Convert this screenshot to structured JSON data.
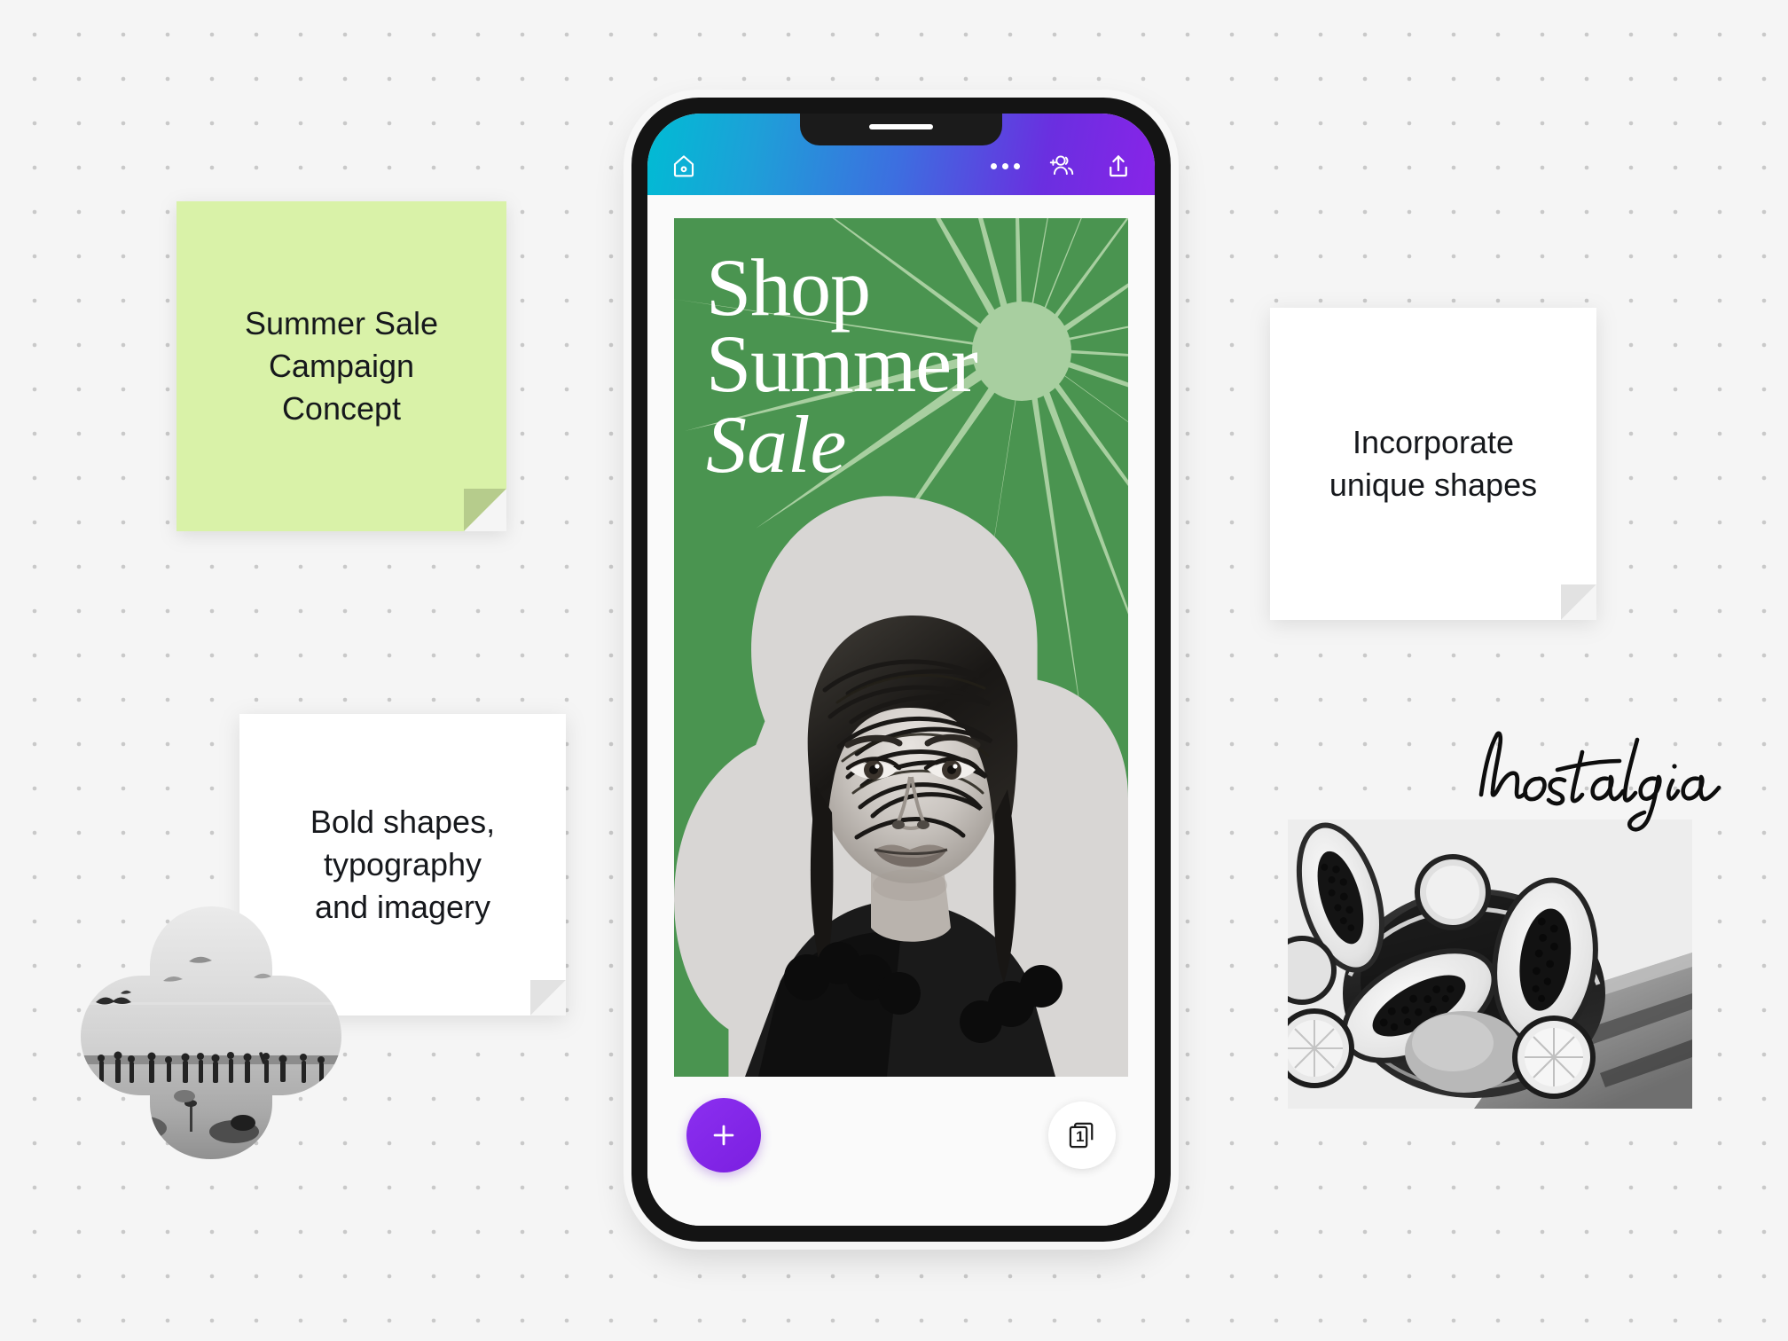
{
  "canvas": {
    "background_color": "#f5f5f5",
    "dot_color": "#c9c9c9"
  },
  "notes": {
    "green": {
      "text": "Summer Sale\nCampaign\nConcept",
      "color": "#d9f2a8"
    },
    "incorporate": {
      "text": "Incorporate\nunique shapes",
      "color": "#ffffff"
    },
    "bold": {
      "text": "Bold shapes,\ntypography\nand imagery",
      "color": "#ffffff"
    }
  },
  "script_text": {
    "nostalgia": "nostalgia"
  },
  "images": {
    "beach": {
      "alt": "Black and white beach scene with people, seagulls and kites",
      "shape": "quatrefoil"
    },
    "papaya": {
      "alt": "Black and white photo of halved papayas and citrus slices in a bowl",
      "shape": "rectangle"
    },
    "portrait": {
      "alt": "Black and white portrait of a woman with windswept dark hair",
      "shape": "cloud-mask"
    }
  },
  "phone": {
    "toolbar": {
      "home_label": "Home",
      "more_label": "More options",
      "collaborate_label": "Invite collaborators",
      "share_label": "Share",
      "gradient_from": "#00bcd4",
      "gradient_mid": "#3d6ee0",
      "gradient_to": "#8824e8"
    },
    "poster": {
      "title_line1": "Shop",
      "title_line2": "Summer",
      "title_line3": "Sale",
      "background_color": "#4a9450",
      "ray_color": "#a8cfa0",
      "ray_count": 20
    },
    "bottom_bar": {
      "add_label": "+",
      "pages_count": "1",
      "add_color": "#7b1fe0"
    }
  }
}
